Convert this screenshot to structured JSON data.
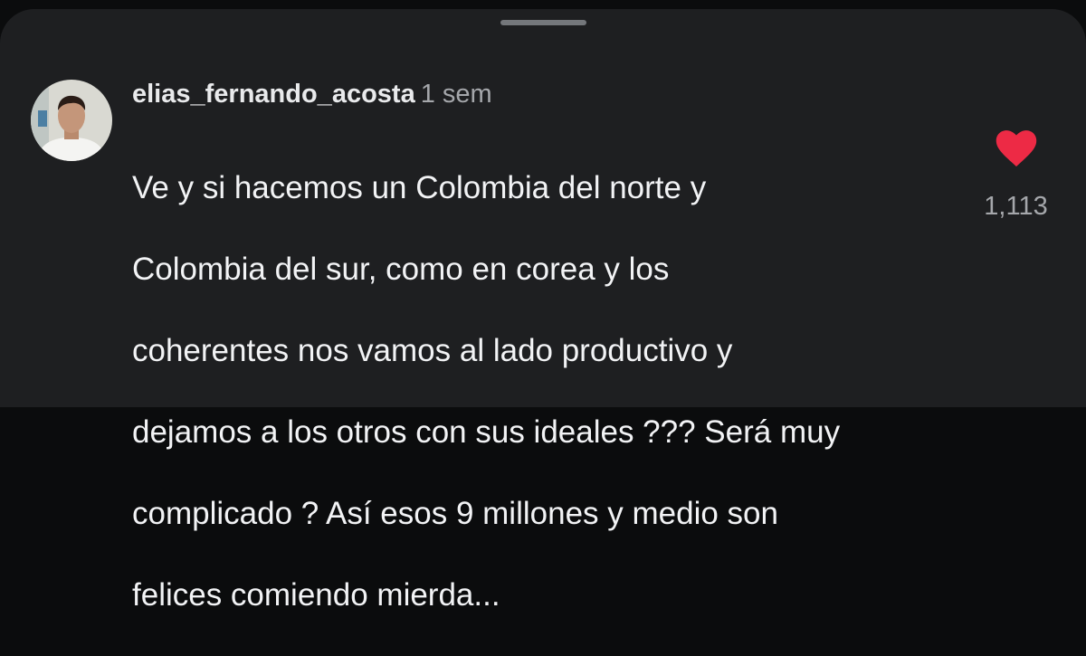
{
  "comment": {
    "username": "elias_fernando_acosta",
    "time": "1 sem",
    "lines": [
      "Ve y si hacemos un Colombia del norte y",
      "Colombia del sur, como en corea y los",
      "coherentes nos vamos al lado productivo y",
      "dejamos a los otros con sus ideales ??? Será muy",
      "complicado ? Así esos 9 millones y medio son",
      "felices comiendo mierda..."
    ],
    "like_count": "1,113",
    "like_icon": "heart-filled-icon",
    "like_color": "#ed2a45",
    "avatar_icon": "user-avatar"
  }
}
